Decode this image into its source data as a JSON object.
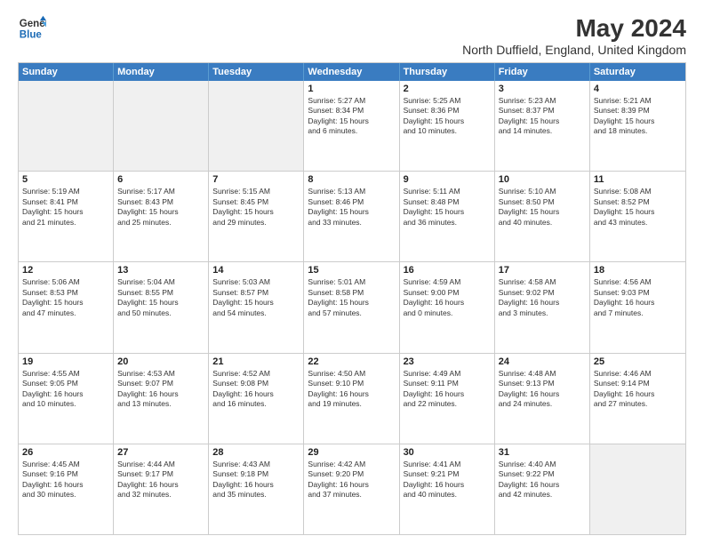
{
  "header": {
    "logo": {
      "line1": "General",
      "line2": "Blue"
    },
    "title": "May 2024",
    "subtitle": "North Duffield, England, United Kingdom"
  },
  "days_of_week": [
    "Sunday",
    "Monday",
    "Tuesday",
    "Wednesday",
    "Thursday",
    "Friday",
    "Saturday"
  ],
  "weeks": [
    [
      {
        "day": "",
        "text": ""
      },
      {
        "day": "",
        "text": ""
      },
      {
        "day": "",
        "text": ""
      },
      {
        "day": "1",
        "text": "Sunrise: 5:27 AM\nSunset: 8:34 PM\nDaylight: 15 hours\nand 6 minutes."
      },
      {
        "day": "2",
        "text": "Sunrise: 5:25 AM\nSunset: 8:36 PM\nDaylight: 15 hours\nand 10 minutes."
      },
      {
        "day": "3",
        "text": "Sunrise: 5:23 AM\nSunset: 8:37 PM\nDaylight: 15 hours\nand 14 minutes."
      },
      {
        "day": "4",
        "text": "Sunrise: 5:21 AM\nSunset: 8:39 PM\nDaylight: 15 hours\nand 18 minutes."
      }
    ],
    [
      {
        "day": "5",
        "text": "Sunrise: 5:19 AM\nSunset: 8:41 PM\nDaylight: 15 hours\nand 21 minutes."
      },
      {
        "day": "6",
        "text": "Sunrise: 5:17 AM\nSunset: 8:43 PM\nDaylight: 15 hours\nand 25 minutes."
      },
      {
        "day": "7",
        "text": "Sunrise: 5:15 AM\nSunset: 8:45 PM\nDaylight: 15 hours\nand 29 minutes."
      },
      {
        "day": "8",
        "text": "Sunrise: 5:13 AM\nSunset: 8:46 PM\nDaylight: 15 hours\nand 33 minutes."
      },
      {
        "day": "9",
        "text": "Sunrise: 5:11 AM\nSunset: 8:48 PM\nDaylight: 15 hours\nand 36 minutes."
      },
      {
        "day": "10",
        "text": "Sunrise: 5:10 AM\nSunset: 8:50 PM\nDaylight: 15 hours\nand 40 minutes."
      },
      {
        "day": "11",
        "text": "Sunrise: 5:08 AM\nSunset: 8:52 PM\nDaylight: 15 hours\nand 43 minutes."
      }
    ],
    [
      {
        "day": "12",
        "text": "Sunrise: 5:06 AM\nSunset: 8:53 PM\nDaylight: 15 hours\nand 47 minutes."
      },
      {
        "day": "13",
        "text": "Sunrise: 5:04 AM\nSunset: 8:55 PM\nDaylight: 15 hours\nand 50 minutes."
      },
      {
        "day": "14",
        "text": "Sunrise: 5:03 AM\nSunset: 8:57 PM\nDaylight: 15 hours\nand 54 minutes."
      },
      {
        "day": "15",
        "text": "Sunrise: 5:01 AM\nSunset: 8:58 PM\nDaylight: 15 hours\nand 57 minutes."
      },
      {
        "day": "16",
        "text": "Sunrise: 4:59 AM\nSunset: 9:00 PM\nDaylight: 16 hours\nand 0 minutes."
      },
      {
        "day": "17",
        "text": "Sunrise: 4:58 AM\nSunset: 9:02 PM\nDaylight: 16 hours\nand 3 minutes."
      },
      {
        "day": "18",
        "text": "Sunrise: 4:56 AM\nSunset: 9:03 PM\nDaylight: 16 hours\nand 7 minutes."
      }
    ],
    [
      {
        "day": "19",
        "text": "Sunrise: 4:55 AM\nSunset: 9:05 PM\nDaylight: 16 hours\nand 10 minutes."
      },
      {
        "day": "20",
        "text": "Sunrise: 4:53 AM\nSunset: 9:07 PM\nDaylight: 16 hours\nand 13 minutes."
      },
      {
        "day": "21",
        "text": "Sunrise: 4:52 AM\nSunset: 9:08 PM\nDaylight: 16 hours\nand 16 minutes."
      },
      {
        "day": "22",
        "text": "Sunrise: 4:50 AM\nSunset: 9:10 PM\nDaylight: 16 hours\nand 19 minutes."
      },
      {
        "day": "23",
        "text": "Sunrise: 4:49 AM\nSunset: 9:11 PM\nDaylight: 16 hours\nand 22 minutes."
      },
      {
        "day": "24",
        "text": "Sunrise: 4:48 AM\nSunset: 9:13 PM\nDaylight: 16 hours\nand 24 minutes."
      },
      {
        "day": "25",
        "text": "Sunrise: 4:46 AM\nSunset: 9:14 PM\nDaylight: 16 hours\nand 27 minutes."
      }
    ],
    [
      {
        "day": "26",
        "text": "Sunrise: 4:45 AM\nSunset: 9:16 PM\nDaylight: 16 hours\nand 30 minutes."
      },
      {
        "day": "27",
        "text": "Sunrise: 4:44 AM\nSunset: 9:17 PM\nDaylight: 16 hours\nand 32 minutes."
      },
      {
        "day": "28",
        "text": "Sunrise: 4:43 AM\nSunset: 9:18 PM\nDaylight: 16 hours\nand 35 minutes."
      },
      {
        "day": "29",
        "text": "Sunrise: 4:42 AM\nSunset: 9:20 PM\nDaylight: 16 hours\nand 37 minutes."
      },
      {
        "day": "30",
        "text": "Sunrise: 4:41 AM\nSunset: 9:21 PM\nDaylight: 16 hours\nand 40 minutes."
      },
      {
        "day": "31",
        "text": "Sunrise: 4:40 AM\nSunset: 9:22 PM\nDaylight: 16 hours\nand 42 minutes."
      },
      {
        "day": "",
        "text": ""
      }
    ]
  ]
}
